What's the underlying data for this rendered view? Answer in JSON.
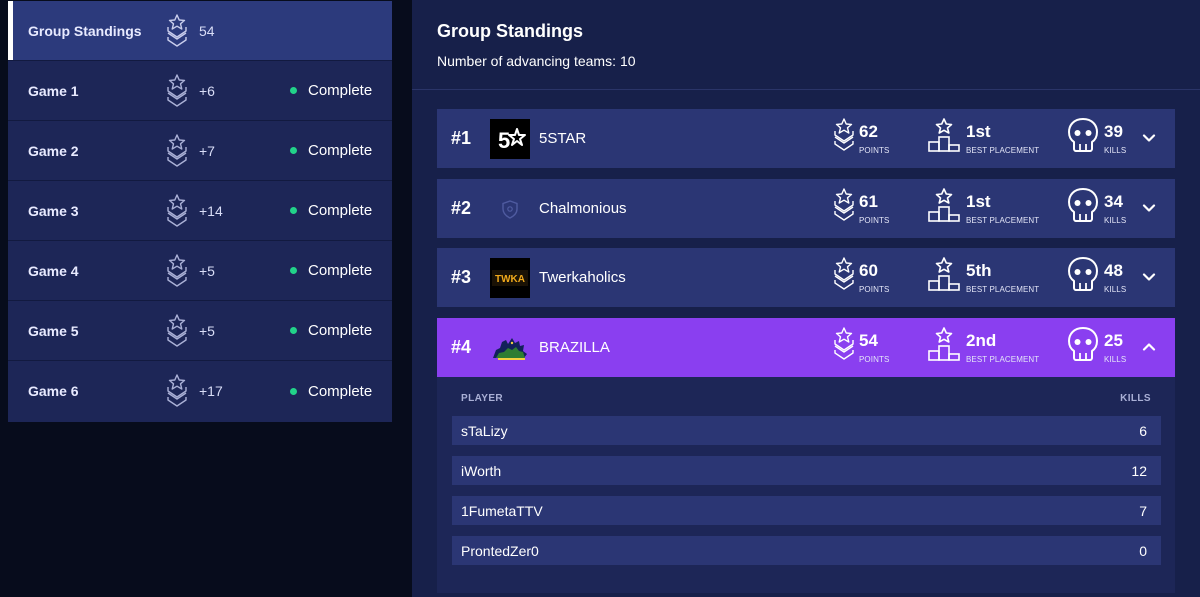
{
  "sidebar": {
    "items": [
      {
        "label": "Group Standings",
        "points": "54",
        "status": "",
        "active": true
      },
      {
        "label": "Game 1",
        "points": "+6",
        "status": "Complete"
      },
      {
        "label": "Game 2",
        "points": "+7",
        "status": "Complete"
      },
      {
        "label": "Game 3",
        "points": "+14",
        "status": "Complete"
      },
      {
        "label": "Game 4",
        "points": "+5",
        "status": "Complete"
      },
      {
        "label": "Game 5",
        "points": "+5",
        "status": "Complete"
      },
      {
        "label": "Game 6",
        "points": "+17",
        "status": "Complete"
      }
    ]
  },
  "main": {
    "title": "Group Standings",
    "advancing_label": "Number of advancing teams:",
    "advancing_value": "10"
  },
  "captions": {
    "points": "POINTS",
    "best_placement": "BEST PLACEMENT",
    "kills": "KILLS"
  },
  "teams": [
    {
      "rank": "#1",
      "name": "5STAR",
      "points": "62",
      "best_placement": "1st",
      "kills": "39",
      "logo_text": "5"
    },
    {
      "rank": "#2",
      "name": "Chalmonious",
      "points": "61",
      "best_placement": "1st",
      "kills": "34"
    },
    {
      "rank": "#3",
      "name": "Twerkaholics",
      "points": "60",
      "best_placement": "5th",
      "kills": "48",
      "logo_text": "TWKA"
    },
    {
      "rank": "#4",
      "name": "BRAZILLA",
      "points": "54",
      "best_placement": "2nd",
      "kills": "25",
      "expanded": true
    }
  ],
  "players": {
    "header_player": "PLAYER",
    "header_kills": "KILLS",
    "rows": [
      {
        "name": "sTaLizy",
        "kills": "6"
      },
      {
        "name": "iWorth",
        "kills": "12"
      },
      {
        "name": "1FumetaTTV",
        "kills": "7"
      },
      {
        "name": "ProntedZer0",
        "kills": "0"
      }
    ]
  },
  "colors": {
    "page_bg": "#070c1c",
    "panel_bg": "#17204a",
    "row_bg": "#2b3674",
    "expanded_bg": "#8a3ff0",
    "status_green": "#22d38a"
  },
  "icons": {
    "points": "chevron-star-icon",
    "placement": "podium-star-icon",
    "kills": "skull-icon"
  }
}
